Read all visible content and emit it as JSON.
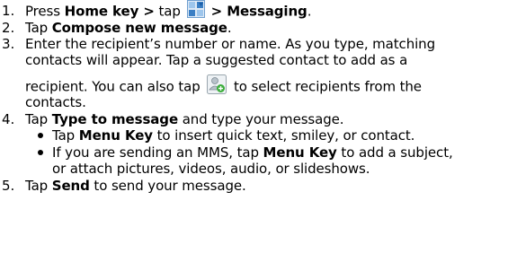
{
  "steps": [
    {
      "num": "1.",
      "t1": "Press ",
      "b1": "Home key >",
      "t2": " tap ",
      "b2": " > Messaging",
      "t3": ".",
      "icon": "launcher-grid-icon"
    },
    {
      "num": "2.",
      "t1": "Tap ",
      "b1": "Compose new message",
      "t2": "."
    },
    {
      "num": "3.",
      "l1": "Enter the recipient’s number or name. As you type, matching",
      "l2": "contacts will appear. Tap a suggested contact to add as a",
      "l3a": "recipient. You can also tap ",
      "l3b": " to select recipients from the",
      "l4": "contacts.",
      "icon": "add-contact-icon"
    },
    {
      "num": "4.",
      "t1": "Tap ",
      "b1": "Type to message",
      "t2": " and type your message.",
      "bullets": [
        {
          "t1": "Tap ",
          "b1": "Menu Key",
          "t2": " to insert quick text, smiley, or contact."
        },
        {
          "t1": "If you are sending an MMS, tap ",
          "b1": "Menu Key",
          "t2": " to add a subject,",
          "l2": "or attach pictures, videos, audio, or slideshows."
        }
      ]
    },
    {
      "num": "5.",
      "t1": "Tap ",
      "b1": "Send",
      "t2": " to send your message."
    }
  ],
  "colors": {
    "text": "#000000",
    "icon_blue": "#3b7fc4",
    "icon_light": "#9ec6ec",
    "icon_green": "#3cae3c"
  }
}
